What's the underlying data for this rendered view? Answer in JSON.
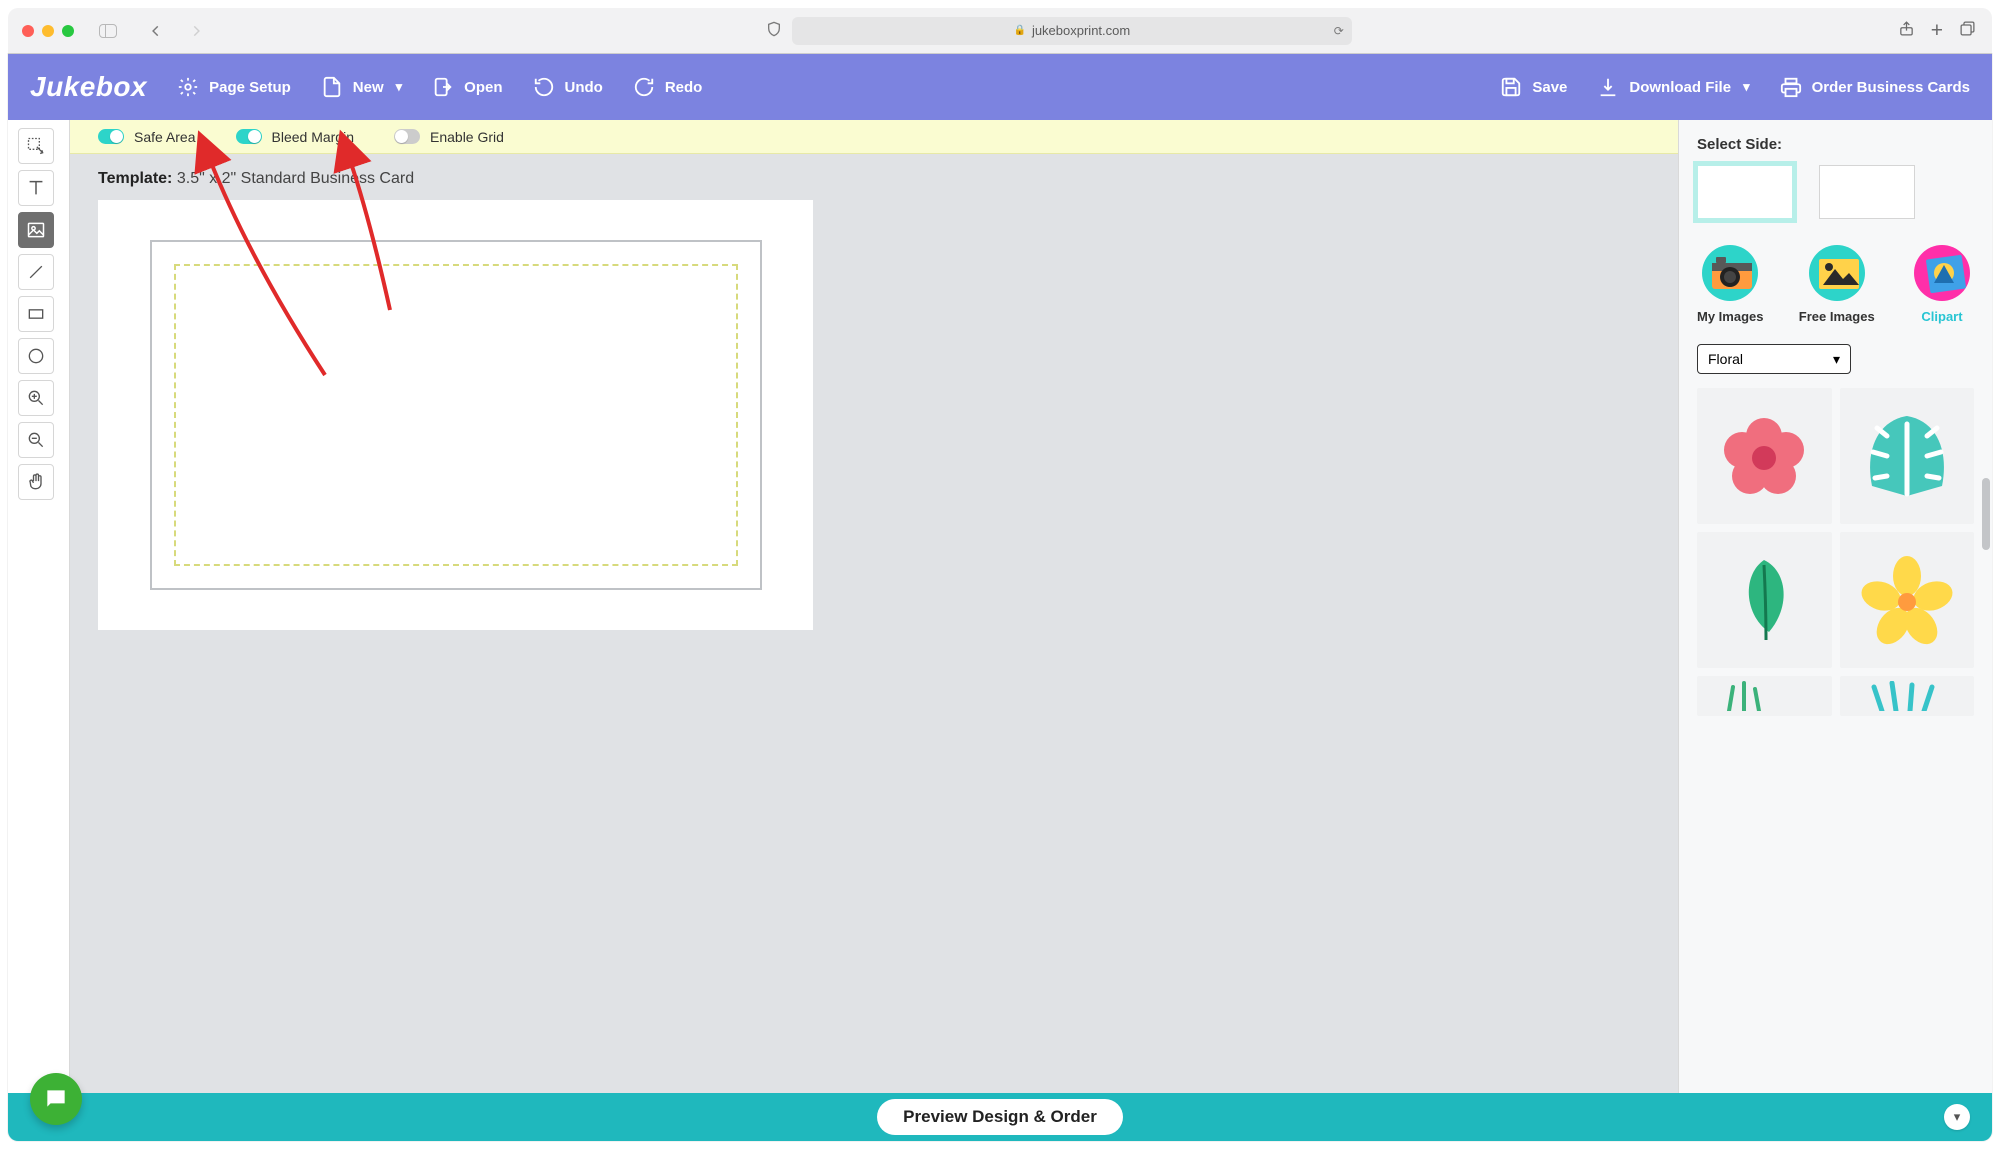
{
  "browser": {
    "url": "jukeboxprint.com"
  },
  "toolbar": {
    "logo": "Jukebox",
    "page_setup": "Page Setup",
    "new": "New",
    "open": "Open",
    "undo": "Undo",
    "redo": "Redo",
    "save": "Save",
    "download": "Download File",
    "order": "Order Business Cards"
  },
  "options": {
    "safe_area_label": "Safe Area",
    "safe_area_on": true,
    "bleed_label": "Bleed Margin",
    "bleed_on": true,
    "grid_label": "Enable Grid",
    "grid_on": false
  },
  "template": {
    "label": "Template:",
    "value": "3.5\" x 2\" Standard Business Card"
  },
  "sidebar_tools": [
    "select",
    "text",
    "image",
    "line",
    "rect",
    "circle",
    "zoom-in",
    "zoom-out",
    "pan"
  ],
  "sidebar_selected": "image",
  "right": {
    "select_side": "Select Side:",
    "tabs": {
      "my": "My Images",
      "free": "Free Images",
      "clipart": "Clipart",
      "active": "clipart"
    },
    "category": "Floral",
    "clipart_items": [
      "hibiscus-pink",
      "monstera-leaf",
      "leaf-green",
      "plumeria-yellow",
      "grass-1",
      "grass-2"
    ]
  },
  "bottom": {
    "preview": "Preview Design & Order"
  }
}
